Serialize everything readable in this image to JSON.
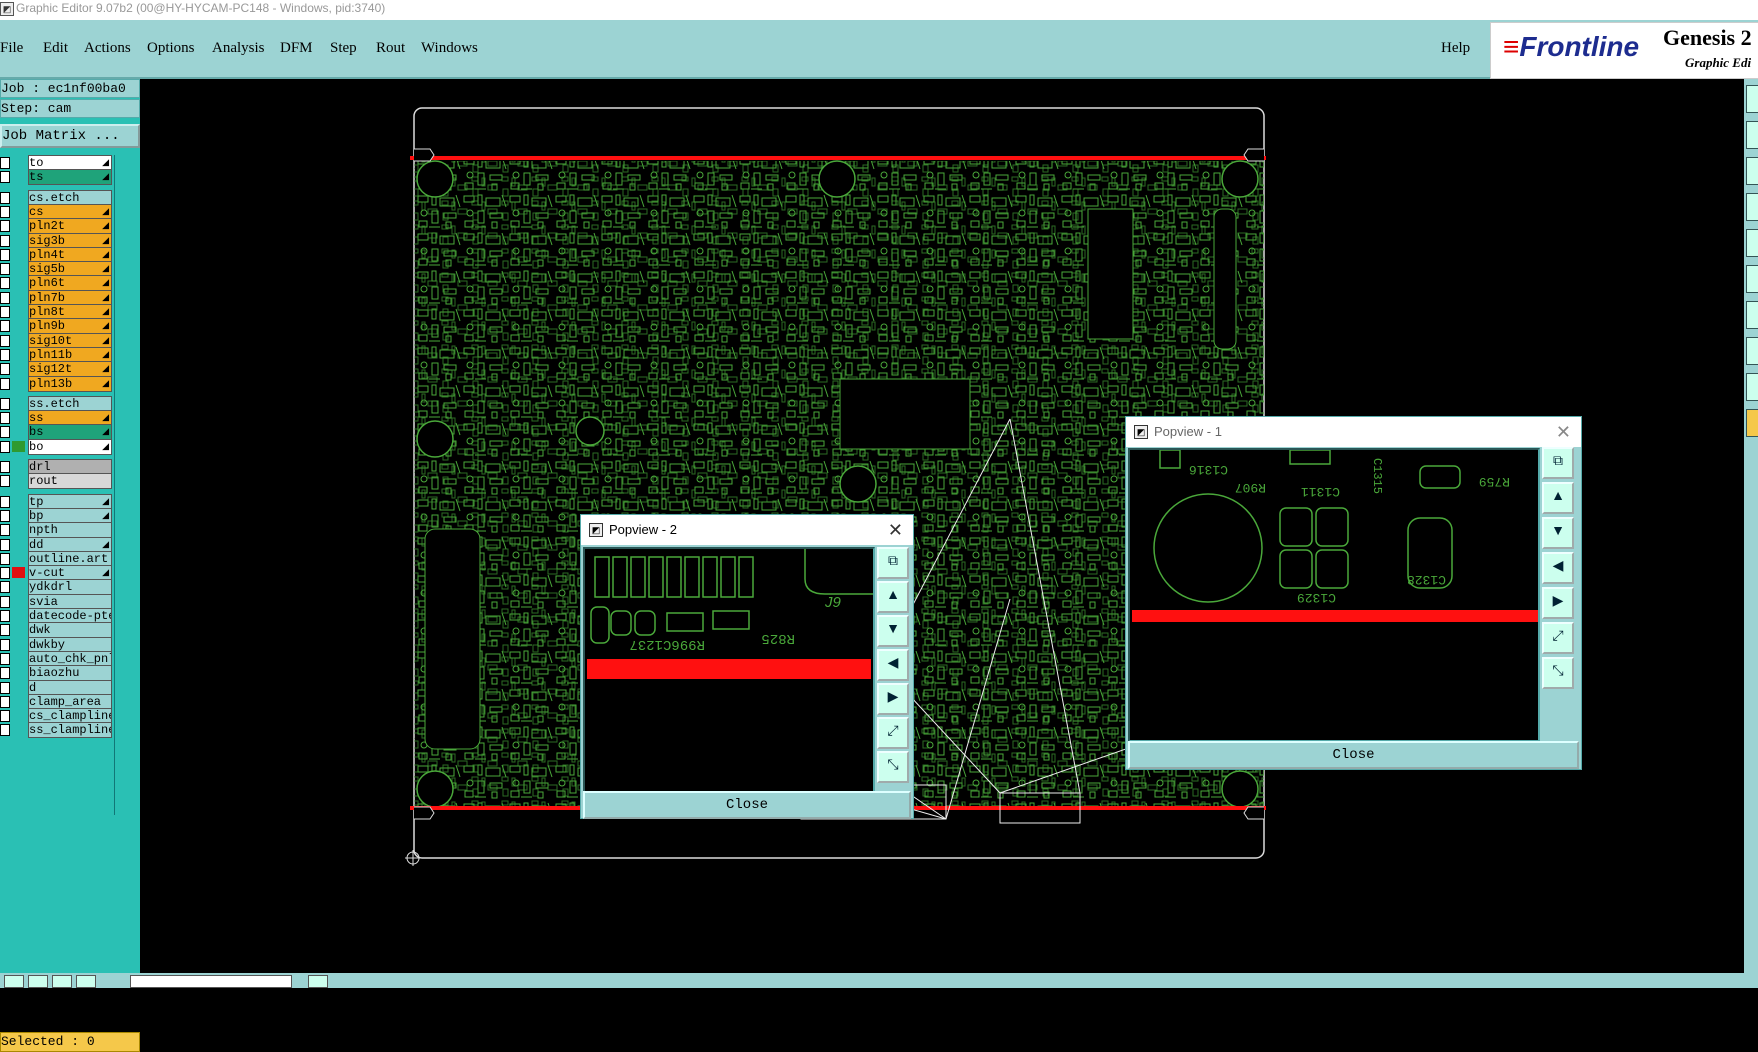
{
  "window": {
    "title": "Graphic Editor 9.07b2 (00@HY-HYCAM-PC148 - Windows, pid:3740)"
  },
  "menu": {
    "items": [
      "File",
      "Edit",
      "Actions",
      "Options",
      "Analysis",
      "DFM",
      "Step",
      "Rout",
      "Windows"
    ],
    "help": "Help"
  },
  "brand": {
    "logo": "Frontline",
    "product": "Genesis 2",
    "subtitle": "Graphic Edi"
  },
  "job": {
    "job_label": "Job : ec1nf00ba0",
    "step_label": "Step: cam",
    "matrix_button": "Job Matrix ..."
  },
  "layers": [
    {
      "name": "to",
      "color": "#ffffff",
      "arrow": true
    },
    {
      "name": "ts",
      "color": "#1fa37a",
      "arrow": true
    },
    {
      "name": "cs.etch",
      "color": "#9cd3d3",
      "arrow": false
    },
    {
      "name": "cs",
      "color": "#f0a820",
      "arrow": true
    },
    {
      "name": "pln2t",
      "color": "#f0a820",
      "arrow": true
    },
    {
      "name": "sig3b",
      "color": "#f0a820",
      "arrow": true
    },
    {
      "name": "pln4t",
      "color": "#f0a820",
      "arrow": true
    },
    {
      "name": "sig5b",
      "color": "#f0a820",
      "arrow": true
    },
    {
      "name": "pln6t",
      "color": "#f0a820",
      "arrow": true
    },
    {
      "name": "pln7b",
      "color": "#f0a820",
      "arrow": true
    },
    {
      "name": "pln8t",
      "color": "#f0a820",
      "arrow": true
    },
    {
      "name": "pln9b",
      "color": "#f0a820",
      "arrow": true
    },
    {
      "name": "sig10t",
      "color": "#f0a820",
      "arrow": true
    },
    {
      "name": "pln11b",
      "color": "#f0a820",
      "arrow": true
    },
    {
      "name": "sig12t",
      "color": "#f0a820",
      "arrow": true
    },
    {
      "name": "pln13b",
      "color": "#f0a820",
      "arrow": true
    },
    {
      "name": "ss.etch",
      "color": "#9cd3d3",
      "arrow": false
    },
    {
      "name": "ss",
      "color": "#f0a820",
      "arrow": true
    },
    {
      "name": "bs",
      "color": "#1fa37a",
      "arrow": true
    },
    {
      "name": "bo",
      "color": "#ffffff",
      "arrow": true
    },
    {
      "name": "drl",
      "color": "#b0b0b0",
      "arrow": false
    },
    {
      "name": "rout",
      "color": "#d8d8d8",
      "arrow": false
    },
    {
      "name": "tp",
      "color": "#9cd3d3",
      "arrow": true
    },
    {
      "name": "bp",
      "color": "#9cd3d3",
      "arrow": true
    },
    {
      "name": "npth",
      "color": "#9cd3d3",
      "arrow": false
    },
    {
      "name": "dd",
      "color": "#9cd3d3",
      "arrow": true
    },
    {
      "name": "outline.art",
      "color": "#9cd3d3",
      "arrow": false
    },
    {
      "name": "v-cut",
      "color": "#9cd3d3",
      "arrow": true
    },
    {
      "name": "ydkdrl",
      "color": "#9cd3d3",
      "arrow": false
    },
    {
      "name": "svia",
      "color": "#9cd3d3",
      "arrow": false
    },
    {
      "name": "datecode-pte",
      "color": "#9cd3d3",
      "arrow": false
    },
    {
      "name": "dwk",
      "color": "#9cd3d3",
      "arrow": false
    },
    {
      "name": "dwkby",
      "color": "#9cd3d3",
      "arrow": false
    },
    {
      "name": "auto_chk_pnl",
      "color": "#9cd3d3",
      "arrow": false
    },
    {
      "name": "biaozhu",
      "color": "#9cd3d3",
      "arrow": false
    },
    {
      "name": "d",
      "color": "#9cd3d3",
      "arrow": false
    },
    {
      "name": "clamp_area",
      "color": "#9cd3d3",
      "arrow": false
    },
    {
      "name": "cs_clampline",
      "color": "#9cd3d3",
      "arrow": false
    },
    {
      "name": "ss_clampline",
      "color": "#9cd3d3",
      "arrow": false
    }
  ],
  "status": {
    "selected": "Selected : 0"
  },
  "popview2": {
    "title": "Popview - 2",
    "close": "Close",
    "labels": [
      "J9",
      "R825",
      "R996C1237"
    ]
  },
  "popview1": {
    "title": "Popview - 1",
    "close": "Close",
    "labels": [
      "C1316",
      "R907",
      "C1311",
      "C1329",
      "C1328",
      "C1315",
      "R759"
    ]
  },
  "colors": {
    "accent": "#9cd3d3",
    "board_trace": "#4aa83a",
    "highlight": "#ff0000",
    "layer_active": "#f0a820"
  }
}
